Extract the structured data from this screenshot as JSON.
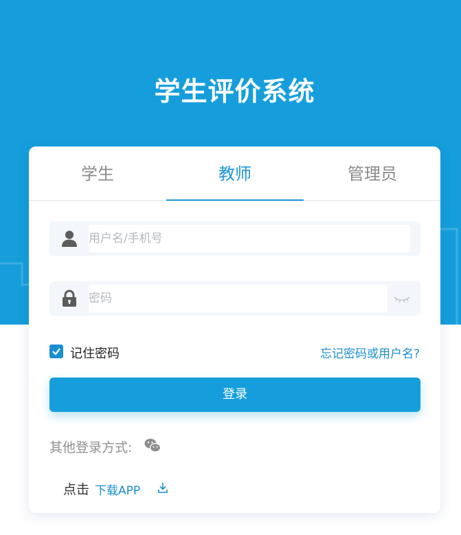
{
  "app": {
    "title": "学生评价系统"
  },
  "tabs": [
    {
      "label": "学生"
    },
    {
      "label": "教师"
    },
    {
      "label": "管理员"
    }
  ],
  "active_tab": "教师",
  "form": {
    "username": {
      "value": "",
      "placeholder": "用户名/手机号",
      "icon": "user-icon"
    },
    "password": {
      "value": "",
      "placeholder": "密码",
      "icon": "lock-icon",
      "toggle_icon": "eye-closed-icon"
    },
    "remember": {
      "label": "记住密码",
      "checked": true
    },
    "forgot_label": "忘记密码或用户名?",
    "login_label": "登录"
  },
  "alt_login": {
    "label": "其他登录方式:",
    "icon": "wechat-icon"
  },
  "download": {
    "prefix": "点击",
    "link_label": "下载APP",
    "icon": "download-icon"
  },
  "colors": {
    "primary": "#159edb",
    "accent_text": "#1a8fcf",
    "field_bg": "#f3f6fa"
  }
}
